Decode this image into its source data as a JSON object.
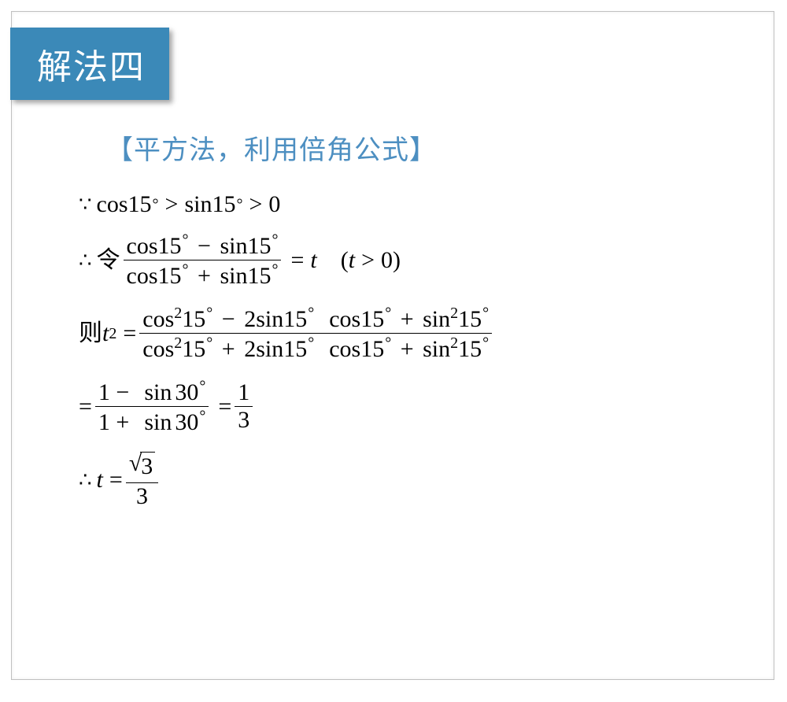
{
  "title": "解法四",
  "subtitle": "【平方法，利用倍角公式】",
  "line1": {
    "prefix": "cos15",
    "gt1": ">",
    "mid": "sin15",
    "gt2": ">",
    "zero": "0"
  },
  "line2": {
    "let": "令",
    "num": {
      "a": "cos15",
      "minus": "−",
      "b": "sin15"
    },
    "den": {
      "a": "cos15",
      "plus": "+",
      "b": "sin15"
    },
    "eq": "=",
    "var": "t",
    "cond_open": "(",
    "cond_var": "t",
    "cond_op": ">",
    "cond_val": "0",
    "cond_close": ")"
  },
  "line3": {
    "then": "则",
    "lhs_var": "t",
    "lhs_exp": "2",
    "eq": "=",
    "num": "cos²15° − 2sin15°cos15° + sin²15°",
    "den": "cos²15° + 2sin15°cos15° + sin²15°"
  },
  "line4": {
    "eq1": "=",
    "f1_num": {
      "one": "1",
      "minus": "−",
      "sin": "sin",
      "ang": "30"
    },
    "f1_den": {
      "one": "1",
      "plus": "+",
      "sin": "sin",
      "ang": "30"
    },
    "eq2": "=",
    "f2_num": "1",
    "f2_den": "3"
  },
  "line5": {
    "var": "t",
    "eq": "=",
    "num_sqrt": "3",
    "den": "3"
  },
  "sym": {
    "cos": "cos",
    "sin": "sin",
    "deg": "°",
    "ang15": "15",
    "ang30": "30",
    "minus": "−",
    "plus": "+",
    "two": "2",
    "sq": "2"
  }
}
